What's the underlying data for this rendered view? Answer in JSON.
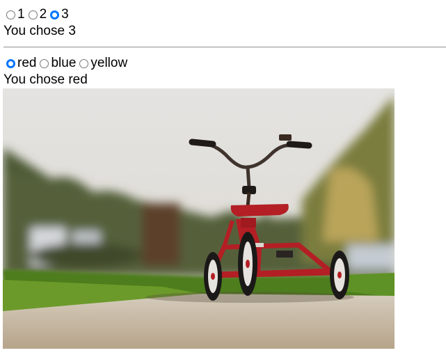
{
  "number_group": {
    "options": [
      "1",
      "2",
      "3"
    ],
    "selected": "3",
    "result_text": "You chose 3"
  },
  "color_group": {
    "options": [
      "red",
      "blue",
      "yellow"
    ],
    "selected": "red",
    "result_text": "You chose red"
  },
  "colors": {
    "accent": "#0075ff",
    "radio_border": "#767676",
    "tricycle_red": "#b31f24",
    "sky": "#e2e1df",
    "grass": "#5c8a22",
    "sidewalk": "#c9bba4"
  }
}
